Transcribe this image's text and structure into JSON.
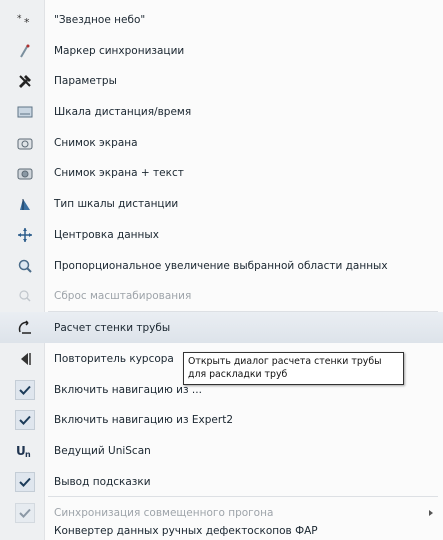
{
  "menu": {
    "items": [
      {
        "label": "\"Звездное небо\"",
        "icon": "starry-sky-icon"
      },
      {
        "label": "Маркер синхронизации",
        "icon": "sync-marker-icon"
      },
      {
        "label": "Параметры",
        "icon": "tools-icon"
      },
      {
        "label": "Шкала дистанция/время",
        "icon": "scale-icon"
      },
      {
        "label": "Снимок экрана",
        "icon": "camera-icon"
      },
      {
        "label": "Снимок экрана + текст",
        "icon": "camera-text-icon"
      },
      {
        "label": "Тип шкалы дистанции",
        "icon": "scale-type-icon"
      },
      {
        "label": "Центровка данных",
        "icon": "center-icon"
      },
      {
        "label": "Пропорциональное увеличение выбранной области данных",
        "icon": "zoom-icon"
      },
      {
        "label": "Сброс масштабирования",
        "icon": "zoom-reset-icon",
        "disabled": true
      },
      {
        "label": "Расчет стенки трубы",
        "icon": "pipe-wall-icon",
        "highlighted": true
      },
      {
        "label": "Повторитель курсора",
        "icon": "cursor-repeater-icon"
      },
      {
        "label": "Включить навигацию из ...",
        "icon": "check-icon",
        "checked": true
      },
      {
        "label": "Включить навигацию из Expert2",
        "icon": "check-icon",
        "checked": true
      },
      {
        "label": "Ведущий UniScan",
        "icon": "uniscan-icon"
      },
      {
        "label": "Вывод подсказки",
        "icon": "check-icon",
        "checked": true
      },
      {
        "label": "Синхронизация совмещенного прогона",
        "icon": "check-icon",
        "checked": true,
        "disabled": true,
        "submenu": true
      },
      {
        "label": "Конвертер данных ручных дефектоскопов ФАР",
        "icon": "none"
      }
    ]
  },
  "tooltip": {
    "text": "Открыть диалог расчета стенки трубы для раскладки труб"
  }
}
